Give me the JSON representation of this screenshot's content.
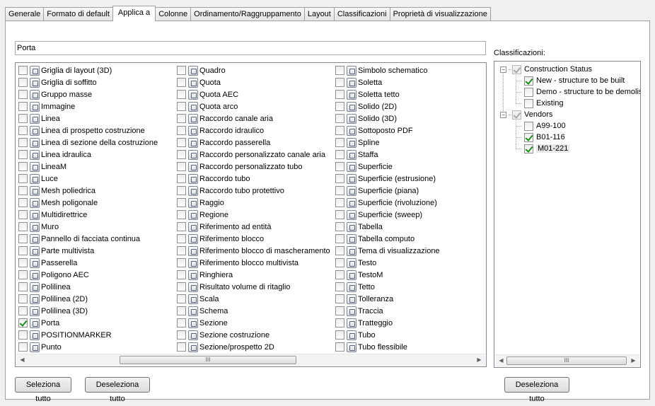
{
  "tabs": [
    {
      "label": "Generale"
    },
    {
      "label": "Formato di default"
    },
    {
      "label": "Applica a",
      "active": true
    },
    {
      "label": "Colonne"
    },
    {
      "label": "Ordinamento/Raggruppamento"
    },
    {
      "label": "Layout"
    },
    {
      "label": "Classificazioni"
    },
    {
      "label": "Proprietà di visualizzazione"
    }
  ],
  "filter": {
    "value": "Porta"
  },
  "object_columns": [
    [
      {
        "label": "Griglia di layout (3D)",
        "checked": false,
        "icon": "layout-grid-3d-icon"
      },
      {
        "label": "Griglia di soffitto",
        "checked": false,
        "icon": "ceiling-grid-icon"
      },
      {
        "label": "Gruppo masse",
        "checked": false,
        "icon": "mass-group-icon"
      },
      {
        "label": "Immagine",
        "checked": false,
        "icon": "image-icon"
      },
      {
        "label": "Linea",
        "checked": false,
        "icon": "line-icon"
      },
      {
        "label": "Linea di prospetto costruzione",
        "checked": false,
        "icon": "elevation-line-icon"
      },
      {
        "label": "Linea di sezione della costruzione",
        "checked": false,
        "icon": "section-line-icon"
      },
      {
        "label": "Linea idraulica",
        "checked": false,
        "icon": "plumbing-line-icon"
      },
      {
        "label": "LineaM",
        "checked": false,
        "icon": "mline-icon"
      },
      {
        "label": "Luce",
        "checked": false,
        "icon": "light-icon"
      },
      {
        "label": "Mesh poliedrica",
        "checked": false,
        "icon": "polyface-mesh-icon"
      },
      {
        "label": "Mesh poligonale",
        "checked": false,
        "icon": "polygon-mesh-icon"
      },
      {
        "label": "Multidirettrice",
        "checked": false,
        "icon": "multileader-icon"
      },
      {
        "label": "Muro",
        "checked": false,
        "icon": "wall-icon"
      },
      {
        "label": "Pannello di facciata continua",
        "checked": false,
        "icon": "curtain-wall-panel-icon"
      },
      {
        "label": "Parte multivista",
        "checked": false,
        "icon": "multiview-part-icon"
      },
      {
        "label": "Passerella",
        "checked": false,
        "icon": "cable-tray-icon"
      },
      {
        "label": "Poligono AEC",
        "checked": false,
        "icon": "aec-polygon-icon"
      },
      {
        "label": "Polilinea",
        "checked": false,
        "icon": "polyline-icon"
      },
      {
        "label": "Polilinea (2D)",
        "checked": false,
        "icon": "polyline-2d-icon"
      },
      {
        "label": "Polilinea (3D)",
        "checked": false,
        "icon": "polyline-3d-icon"
      },
      {
        "label": "Porta",
        "checked": true,
        "icon": "door-icon"
      },
      {
        "label": "POSITIONMARKER",
        "checked": false,
        "icon": "position-marker-icon"
      },
      {
        "label": "Punto",
        "checked": false,
        "icon": "point-icon"
      }
    ],
    [
      {
        "label": "Quadro",
        "checked": false,
        "icon": "panel-board-icon"
      },
      {
        "label": "Quota",
        "checked": false,
        "icon": "dimension-icon"
      },
      {
        "label": "Quota AEC",
        "checked": false,
        "icon": "aec-dimension-icon"
      },
      {
        "label": "Quota arco",
        "checked": false,
        "icon": "arc-dimension-icon"
      },
      {
        "label": "Raccordo canale aria",
        "checked": false,
        "icon": "duct-fitting-icon"
      },
      {
        "label": "Raccordo idraulico",
        "checked": false,
        "icon": "plumbing-fitting-icon"
      },
      {
        "label": "Raccordo passerella",
        "checked": false,
        "icon": "cable-tray-fitting-icon"
      },
      {
        "label": "Raccordo personalizzato canale aria",
        "checked": false,
        "icon": "custom-duct-fitting-icon"
      },
      {
        "label": "Raccordo personalizzato tubo",
        "checked": false,
        "icon": "custom-pipe-fitting-icon"
      },
      {
        "label": "Raccordo tubo",
        "checked": false,
        "icon": "pipe-fitting-icon"
      },
      {
        "label": "Raccordo tubo protettivo",
        "checked": false,
        "icon": "conduit-fitting-icon"
      },
      {
        "label": "Raggio",
        "checked": false,
        "icon": "ray-icon"
      },
      {
        "label": "Regione",
        "checked": false,
        "icon": "region-icon"
      },
      {
        "label": "Riferimento ad entità",
        "checked": false,
        "icon": "entity-reference-icon"
      },
      {
        "label": "Riferimento blocco",
        "checked": false,
        "icon": "block-reference-icon"
      },
      {
        "label": "Riferimento blocco di mascheramento",
        "checked": false,
        "icon": "masking-block-reference-icon"
      },
      {
        "label": "Riferimento blocco multivista",
        "checked": false,
        "icon": "multiview-block-reference-icon"
      },
      {
        "label": "Ringhiera",
        "checked": false,
        "icon": "railing-icon"
      },
      {
        "label": "Risultato volume di ritaglio",
        "checked": false,
        "icon": "clip-volume-result-icon"
      },
      {
        "label": "Scala",
        "checked": false,
        "icon": "stair-icon"
      },
      {
        "label": "Schema",
        "checked": false,
        "icon": "schematic-line-icon"
      },
      {
        "label": "Sezione",
        "checked": false,
        "icon": "section-icon"
      },
      {
        "label": "Sezione costruzione",
        "checked": false,
        "icon": "building-section-icon"
      },
      {
        "label": "Sezione/prospetto 2D",
        "checked": false,
        "icon": "section-elevation-2d-icon"
      }
    ],
    [
      {
        "label": "Simbolo schematico",
        "checked": false,
        "icon": "schematic-symbol-icon"
      },
      {
        "label": "Soletta",
        "checked": false,
        "icon": "slab-icon"
      },
      {
        "label": "Soletta tetto",
        "checked": false,
        "icon": "roof-slab-icon"
      },
      {
        "label": "Solido (2D)",
        "checked": false,
        "icon": "solid-2d-icon"
      },
      {
        "label": "Solido (3D)",
        "checked": false,
        "icon": "solid-3d-icon"
      },
      {
        "label": "Sottoposto PDF",
        "checked": false,
        "icon": "pdf-underlay-icon"
      },
      {
        "label": "Spline",
        "checked": false,
        "icon": "spline-icon"
      },
      {
        "label": "Staffa",
        "checked": false,
        "icon": "hanger-icon"
      },
      {
        "label": "Superficie",
        "checked": false,
        "icon": "surface-icon"
      },
      {
        "label": "Superficie (estrusione)",
        "checked": false,
        "icon": "extruded-surface-icon"
      },
      {
        "label": "Superficie (piana)",
        "checked": false,
        "icon": "planar-surface-icon"
      },
      {
        "label": "Superficie (rivoluzione)",
        "checked": false,
        "icon": "revolved-surface-icon"
      },
      {
        "label": "Superficie (sweep)",
        "checked": false,
        "icon": "swept-surface-icon"
      },
      {
        "label": "Tabella",
        "checked": false,
        "icon": "table-icon"
      },
      {
        "label": "Tabella computo",
        "checked": false,
        "icon": "schedule-table-icon"
      },
      {
        "label": "Tema di visualizzazione",
        "checked": false,
        "icon": "display-theme-icon"
      },
      {
        "label": "Testo",
        "checked": false,
        "icon": "text-icon"
      },
      {
        "label": "TestoM",
        "checked": false,
        "icon": "mtext-icon"
      },
      {
        "label": "Tetto",
        "checked": false,
        "icon": "roof-icon"
      },
      {
        "label": "Tolleranza",
        "checked": false,
        "icon": "tolerance-icon"
      },
      {
        "label": "Traccia",
        "checked": false,
        "icon": "trace-icon"
      },
      {
        "label": "Tratteggio",
        "checked": false,
        "icon": "hatch-icon"
      },
      {
        "label": "Tubo",
        "checked": false,
        "icon": "pipe-icon"
      },
      {
        "label": "Tubo flessibile",
        "checked": false,
        "icon": "flex-pipe-icon"
      }
    ]
  ],
  "buttons": {
    "select_all": "Seleziona tutto",
    "deselect_all": "Deseleziona tutto",
    "classifications_deselect_all": "Deseleziona tutto"
  },
  "classifications": {
    "label": "Classificazioni:",
    "tree": [
      {
        "label": "Construction Status",
        "level": 0,
        "checked": true,
        "gray": true,
        "expander": "−"
      },
      {
        "label": "New - structure to be built",
        "level": 1,
        "checked": true
      },
      {
        "label": "Demo - structure to be demolis",
        "level": 1,
        "checked": false
      },
      {
        "label": "Existing",
        "level": 1,
        "checked": false
      },
      {
        "label": "Vendors",
        "level": 0,
        "checked": true,
        "gray": true,
        "expander": "−"
      },
      {
        "label": "A99-100",
        "level": 1,
        "checked": false
      },
      {
        "label": "B01-116",
        "level": 1,
        "checked": true
      },
      {
        "label": "M01-221",
        "level": 1,
        "checked": true,
        "selected": true
      }
    ]
  },
  "scrollbar": {
    "left_arrow": "◀",
    "right_arrow": "▶",
    "grip": "III"
  }
}
